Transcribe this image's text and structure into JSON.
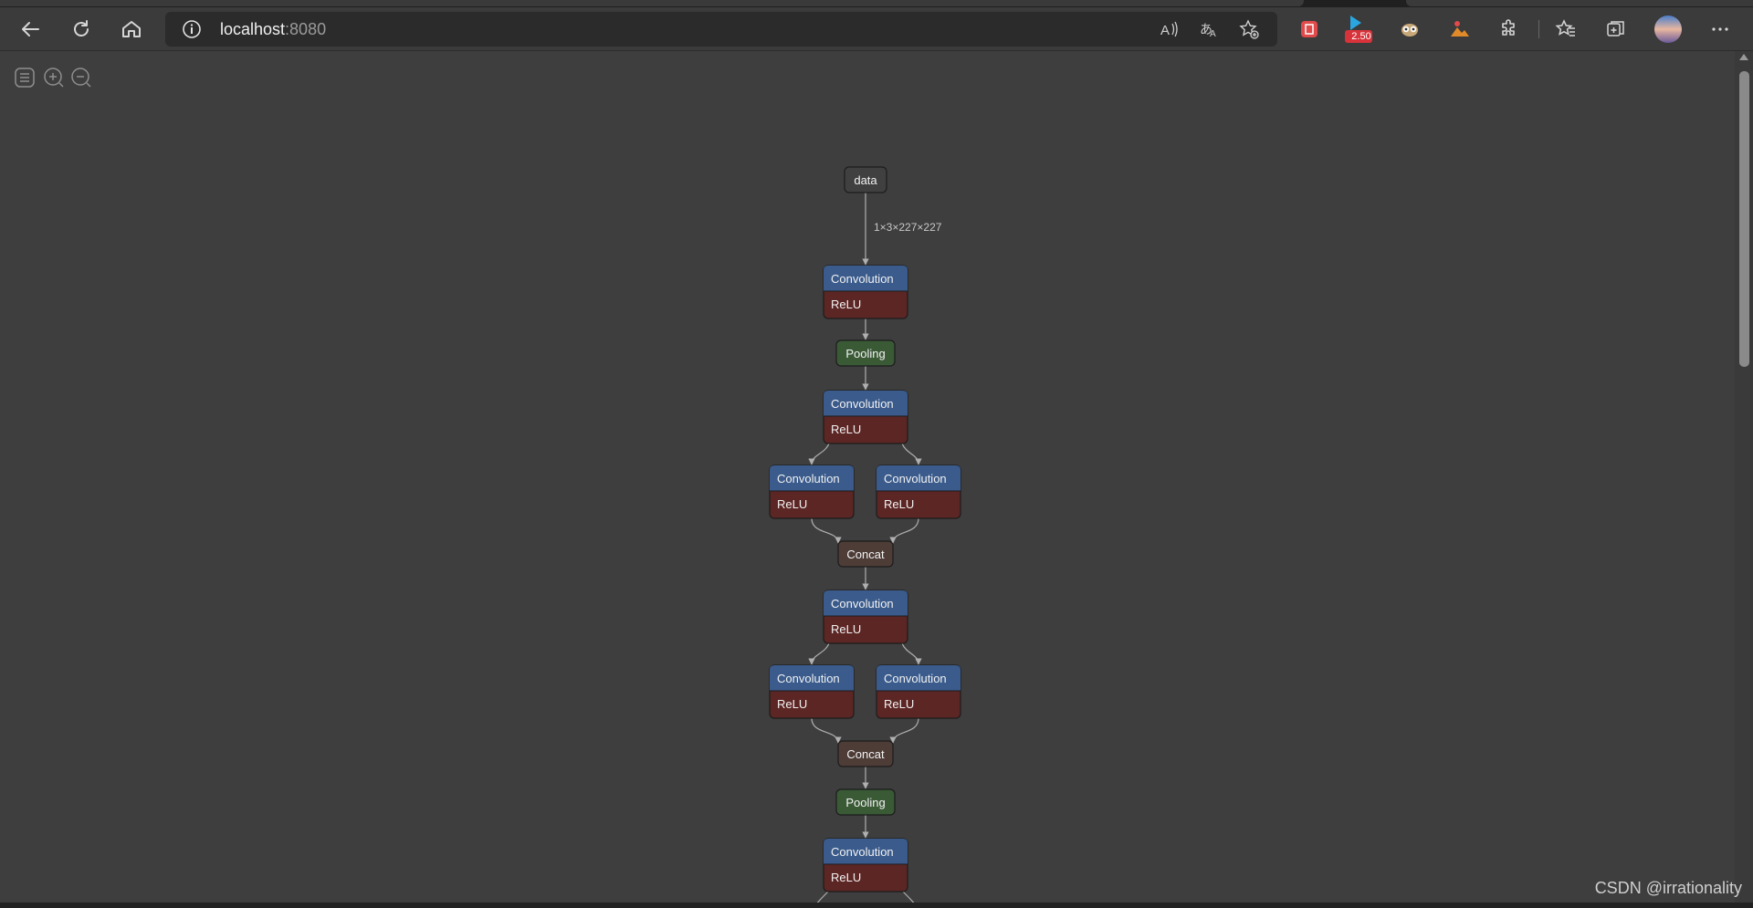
{
  "browser": {
    "url_host": "localhost",
    "url_port": ":8080",
    "badge_count": "2.50"
  },
  "graph": {
    "edge_label": "1×3×227×227",
    "nodes": [
      {
        "id": "n0",
        "kind": "input",
        "labels": [
          "data"
        ]
      },
      {
        "id": "n1",
        "kind": "conv",
        "labels": [
          "Convolution",
          "ReLU"
        ]
      },
      {
        "id": "n2",
        "kind": "pool",
        "labels": [
          "Pooling"
        ]
      },
      {
        "id": "n3",
        "kind": "conv",
        "labels": [
          "Convolution",
          "ReLU"
        ]
      },
      {
        "id": "n4",
        "kind": "conv",
        "labels": [
          "Convolution",
          "ReLU"
        ]
      },
      {
        "id": "n5",
        "kind": "conv",
        "labels": [
          "Convolution",
          "ReLU"
        ]
      },
      {
        "id": "n6",
        "kind": "concat",
        "labels": [
          "Concat"
        ]
      },
      {
        "id": "n7",
        "kind": "conv",
        "labels": [
          "Convolution",
          "ReLU"
        ]
      },
      {
        "id": "n8",
        "kind": "conv",
        "labels": [
          "Convolution",
          "ReLU"
        ]
      },
      {
        "id": "n9",
        "kind": "conv",
        "labels": [
          "Convolution",
          "ReLU"
        ]
      },
      {
        "id": "n10",
        "kind": "concat",
        "labels": [
          "Concat"
        ]
      },
      {
        "id": "n11",
        "kind": "pool",
        "labels": [
          "Pooling"
        ]
      },
      {
        "id": "n12",
        "kind": "conv",
        "labels": [
          "Convolution",
          "ReLU"
        ]
      }
    ]
  },
  "watermark": "CSDN @irrationality",
  "colors": {
    "conv_header": "#3a5b8c",
    "relu_body": "#5c2624",
    "pool": "#3a5a36",
    "concat": "#4e3d37",
    "input": "#404040",
    "edge": "#b0b0b0"
  }
}
